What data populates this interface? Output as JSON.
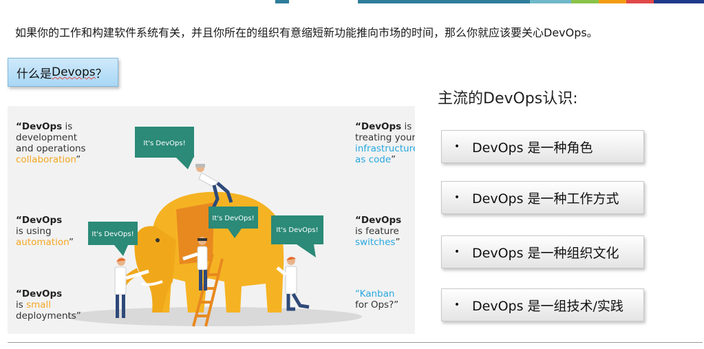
{
  "colors": {
    "top_bar": [
      "#2e7d9a",
      "#6fb8c9",
      "#8bc34a",
      "#f39c12",
      "#e04848",
      "#1e3a8a"
    ],
    "bubble": "#2b8a78",
    "elephant": "#f5b323",
    "accent_orange": "#f5a623",
    "accent_blue": "#29a8e0"
  },
  "intro": "如果你的工作和构建软件系统有关，并且你所在的组织有意缩短新功能推向市场的时间，那么你就应该要关心DevOps。",
  "question": {
    "pre": "什么是",
    "underlined": "Devops",
    "post": "？"
  },
  "views": {
    "title": "主流的DevOps认识:",
    "bullet": "•",
    "items": [
      {
        "label": "DevOps 是一种角色"
      },
      {
        "label": "DevOps 是一种工作方式"
      },
      {
        "label": "DevOps 是一种组织文化"
      },
      {
        "label": "DevOps 是一组技术/实践"
      }
    ]
  },
  "illustration": {
    "bubble_text": "It's DevOps!",
    "quotes": {
      "q1": {
        "strong": "“DevOps",
        "l1": " is",
        "l2": "development",
        "l3": "and operations",
        "accent": "collaboration",
        "end": "”"
      },
      "q2": {
        "strong": "“DevOps",
        "l1": "is using",
        "accent": "automation",
        "end": "”"
      },
      "q3": {
        "strong": "“DevOps",
        "pre": "is ",
        "accent": "small",
        "l3": "deployments”"
      },
      "q4": {
        "strong": "“DevOps",
        "l1": " is",
        "l2": "treating your",
        "accent1": "infrastructure",
        "accent2": "as code",
        "end": "”"
      },
      "q5": {
        "strong": "“DevOps",
        "l1": "is feature",
        "accent": "switches",
        "end": "”"
      },
      "q6": {
        "accent": "“Kanban",
        "l2": "for Ops?”"
      }
    }
  }
}
